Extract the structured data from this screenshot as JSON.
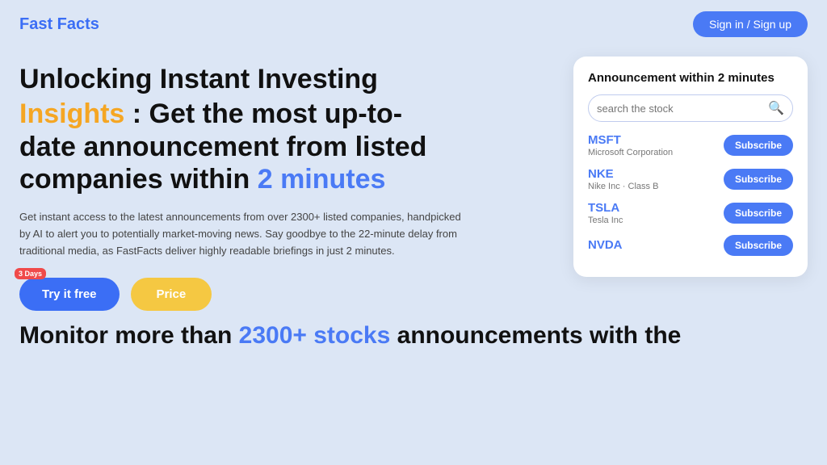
{
  "header": {
    "logo": "Fast Facts",
    "sign_in_label": "Sign in / Sign up"
  },
  "hero": {
    "headline_line1": "Unlocking Instant Investing",
    "insights_word": "Insights",
    "headline_middle": " : Get the most up-to-date announcement from listed companies within ",
    "minutes_word": "2 minutes",
    "subtext": "Get instant access to the latest announcements from over 2300+ listed companies, handpicked by AI to alert you to potentially market-moving news. Say goodbye to the 22-minute delay from traditional media, as FastFacts deliver highly readable briefings in just 2 minutes.",
    "badge": "3 Days",
    "try_free_label": "Try it free",
    "price_label": "Price"
  },
  "card": {
    "title": "Announcement within 2 minutes",
    "search_placeholder": "search the stock",
    "stocks": [
      {
        "ticker": "MSFT",
        "name": "Microsoft Corporation"
      },
      {
        "ticker": "NKE",
        "name": "Nike Inc · Class B"
      },
      {
        "ticker": "TSLA",
        "name": "Tesla Inc"
      },
      {
        "ticker": "NVDA",
        "name": ""
      }
    ],
    "subscribe_label": "Subscribe"
  },
  "bottom_teaser": {
    "prefix": "Monitor more than ",
    "highlight": "2300+ stocks",
    "suffix": " announcements with the"
  }
}
